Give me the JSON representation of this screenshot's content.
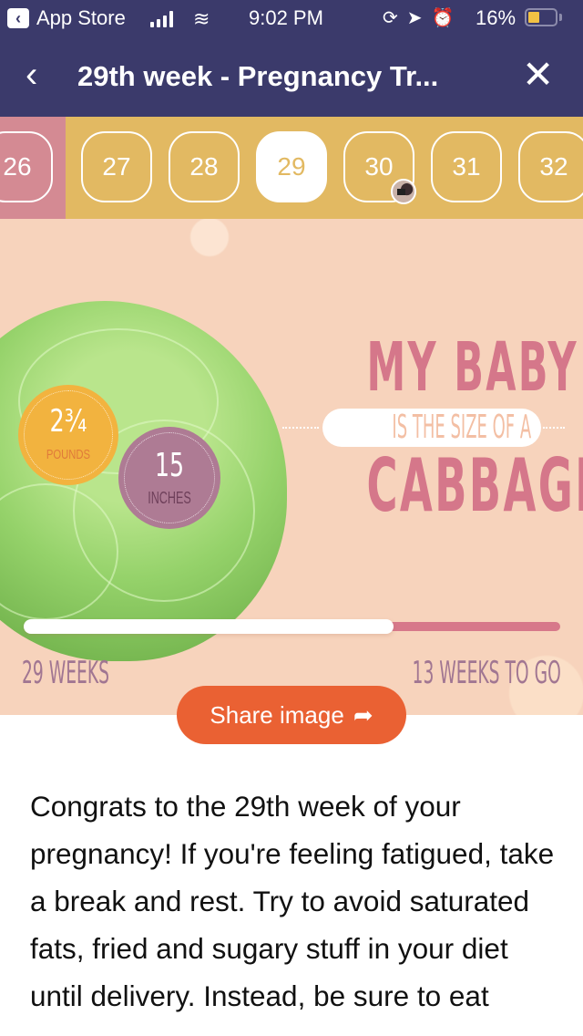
{
  "status_bar": {
    "back_app": "App Store",
    "time": "9:02 PM",
    "battery_percent": "16%",
    "battery_level": 0.16,
    "icons": [
      "orientation-lock-icon",
      "location-icon",
      "alarm-icon"
    ]
  },
  "nav": {
    "title": "29th week - Pregnancy Tr...",
    "back_icon": "‹",
    "close_icon": "✕"
  },
  "weeks": {
    "items": [
      "26",
      "27",
      "28",
      "29",
      "30",
      "31",
      "32"
    ],
    "selected": "29",
    "colors": {
      "past": "#d48a93",
      "future": "#e2b962",
      "selected_bg": "#ffffff"
    }
  },
  "hero": {
    "weight_value": "2¾",
    "weight_unit": "POUNDS",
    "length_value": "15",
    "length_unit": "INCHES",
    "headline_top": "MY BABY",
    "headline_middle": "IS THE SIZE OF A",
    "headline_bottom": "CABBAGE",
    "progress_fraction": 0.69,
    "weeks_done": "29 WEEKS",
    "weeks_to_go": "13 WEEKS TO GO"
  },
  "share": {
    "label": "Share image",
    "icon": "➦",
    "color": "#ea6133"
  },
  "article": {
    "text": "Congrats to the 29th week of your pregnancy! If you're feeling fatigued, take a break and rest. Try to avoid saturated fats, fried and sugary stuff in your diet until delivery. Instead, be sure to eat"
  }
}
